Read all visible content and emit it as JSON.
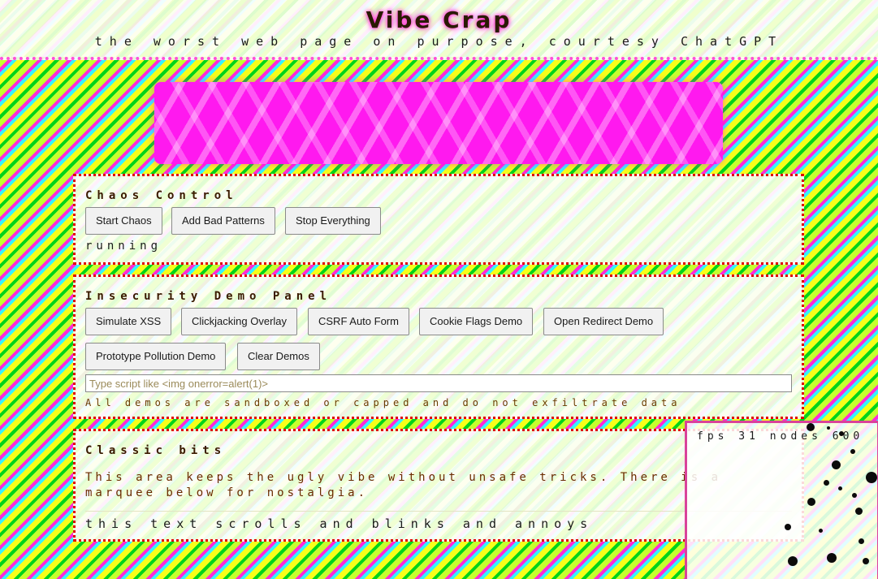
{
  "header": {
    "title": "Vibe Crap",
    "subtitle": "the worst web page on purpose, courtesy ChatGPT"
  },
  "chaos_control": {
    "title": "Chaos Control",
    "buttons": [
      "Start Chaos",
      "Add Bad Patterns",
      "Stop Everything"
    ],
    "status": "running"
  },
  "insecurity_panel": {
    "title": "Insecurity Demo Panel",
    "buttons": [
      "Simulate XSS",
      "Clickjacking Overlay",
      "CSRF Auto Form",
      "Cookie Flags Demo",
      "Open Redirect Demo",
      "Prototype Pollution Demo",
      "Clear Demos"
    ],
    "input_placeholder": "Type script like <img onerror=alert(1)>",
    "input_value": "",
    "note": "All demos are sandboxed or capped and do not exfiltrate data"
  },
  "classic_bits": {
    "title": "Classic bits",
    "text": "This area keeps the ugly vibe without unsafe tricks. There is a marquee below for nostalgia.",
    "marquee": "this text scrolls and blinks and annoys"
  },
  "fps_overlay": {
    "text": "fps 31 nodes 600"
  },
  "colors": {
    "banner": "#ff19ef",
    "panel_border": "#e00000",
    "overlay_border": "#d9439a"
  }
}
